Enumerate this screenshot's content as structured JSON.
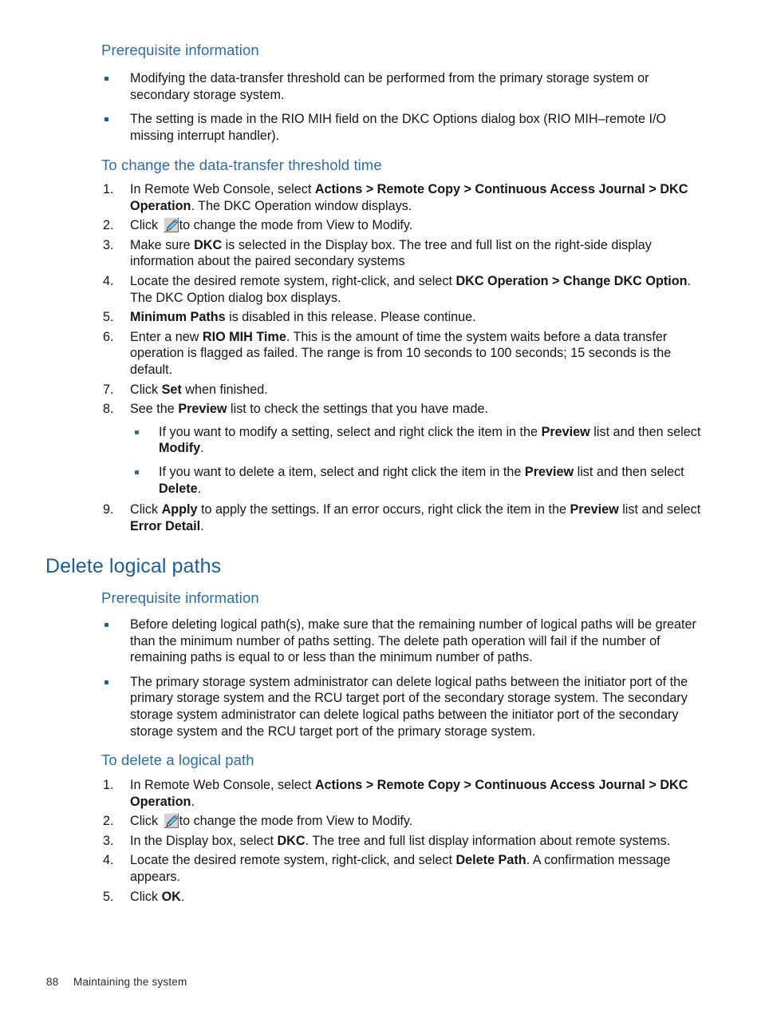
{
  "document": {
    "footer": {
      "page_number": "88",
      "chapter": "Maintaining the system"
    },
    "colors": {
      "heading_primary": "#1b5e9e",
      "heading_secondary": "#2d6ca8",
      "body": "#161616",
      "bullet": "#1b5e9e"
    }
  },
  "section_a": {
    "prereq_heading": "Prerequisite information",
    "prereq_bullets": [
      {
        "parts": [
          {
            "t": "Modifying the data-transfer threshold can be performed from the primary storage system or secondary storage system.",
            "b": false
          }
        ]
      },
      {
        "parts": [
          {
            "t": "The setting is made in the RIO MIH field on the DKC Options dialog box (RIO MIH–remote I/O missing interrupt handler).",
            "b": false
          }
        ]
      }
    ],
    "procedure_heading": "To change the data-transfer threshold time",
    "steps": [
      {
        "num": "1.",
        "parts": [
          {
            "t": "In Remote Web Console, select ",
            "b": false
          },
          {
            "t": "Actions > Remote Copy > Continuous Access Journal > DKC Operation",
            "b": true
          },
          {
            "t": ". The DKC Operation window displays.",
            "b": false
          }
        ]
      },
      {
        "num": "2.",
        "icon": "pencil-icon",
        "parts": [
          {
            "t": "Click ",
            "b": false
          },
          {
            "t": "__ICON__",
            "b": false
          },
          {
            "t": "to change the mode from View to Modify.",
            "b": false
          }
        ]
      },
      {
        "num": "3.",
        "parts": [
          {
            "t": "Make sure ",
            "b": false
          },
          {
            "t": "DKC",
            "b": true
          },
          {
            "t": " is selected in the Display box. The tree and full list on the right-side display information about the paired secondary systems",
            "b": false
          }
        ]
      },
      {
        "num": "4.",
        "parts": [
          {
            "t": "Locate the desired remote system, right-click, and select ",
            "b": false
          },
          {
            "t": "DKC Operation > Change DKC Option",
            "b": true
          },
          {
            "t": ". The DKC Option dialog box displays.",
            "b": false
          }
        ]
      },
      {
        "num": "5.",
        "parts": [
          {
            "t": "Minimum Paths",
            "b": true
          },
          {
            "t": " is disabled in this release. Please continue.",
            "b": false
          }
        ]
      },
      {
        "num": "6.",
        "parts": [
          {
            "t": "Enter a new ",
            "b": false
          },
          {
            "t": "RIO MIH Time",
            "b": true
          },
          {
            "t": ". This is the amount of time the system waits before a data transfer operation is flagged as failed. The range is from 10 seconds to 100 seconds; 15 seconds is the default.",
            "b": false
          }
        ]
      },
      {
        "num": "7.",
        "parts": [
          {
            "t": "Click ",
            "b": false
          },
          {
            "t": "Set",
            "b": true
          },
          {
            "t": " when finished.",
            "b": false
          }
        ]
      },
      {
        "num": "8.",
        "parts": [
          {
            "t": "See the ",
            "b": false
          },
          {
            "t": "Preview",
            "b": true
          },
          {
            "t": " list to check the settings that you have made.",
            "b": false
          }
        ],
        "subbullets": [
          {
            "parts": [
              {
                "t": "If you want to modify a setting, select and right click the item in the ",
                "b": false
              },
              {
                "t": "Preview",
                "b": true
              },
              {
                "t": " list and then select ",
                "b": false
              },
              {
                "t": "Modify",
                "b": true
              },
              {
                "t": ".",
                "b": false
              }
            ]
          },
          {
            "parts": [
              {
                "t": "If you want to delete a item, select and right click the item in the ",
                "b": false
              },
              {
                "t": "Preview",
                "b": true
              },
              {
                "t": " list and then select ",
                "b": false
              },
              {
                "t": "Delete",
                "b": true
              },
              {
                "t": ".",
                "b": false
              }
            ]
          }
        ]
      },
      {
        "num": "9.",
        "parts": [
          {
            "t": "Click ",
            "b": false
          },
          {
            "t": "Apply",
            "b": true
          },
          {
            "t": " to apply the settings. If an error occurs, right click the item in the ",
            "b": false
          },
          {
            "t": "Preview",
            "b": true
          },
          {
            "t": " list and select ",
            "b": false
          },
          {
            "t": "Error Detail",
            "b": true
          },
          {
            "t": ".",
            "b": false
          }
        ]
      }
    ]
  },
  "section_b": {
    "title": "Delete logical paths",
    "prereq_heading": "Prerequisite information",
    "prereq_bullets": [
      {
        "parts": [
          {
            "t": "Before deleting logical path(s), make sure that the remaining number of logical paths will be greater than the minimum number of paths setting. The delete path operation will fail if the number of remaining paths is equal to or less than the minimum number of paths.",
            "b": false
          }
        ]
      },
      {
        "parts": [
          {
            "t": "The primary storage system administrator can delete logical paths between the initiator port of the primary storage system and the RCU target port of the secondary storage system. The secondary storage system administrator can delete logical paths between the initiator port of the secondary storage system and the RCU target port of the primary storage system.",
            "b": false
          }
        ]
      }
    ],
    "procedure_heading": "To delete a logical path",
    "steps": [
      {
        "num": "1.",
        "parts": [
          {
            "t": "In Remote Web Console, select ",
            "b": false
          },
          {
            "t": "Actions > Remote Copy > Continuous Access Journal > DKC Operation",
            "b": true
          },
          {
            "t": ".",
            "b": false
          }
        ]
      },
      {
        "num": "2.",
        "icon": "pencil-icon",
        "parts": [
          {
            "t": "Click ",
            "b": false
          },
          {
            "t": "__ICON__",
            "b": false
          },
          {
            "t": "to change the mode from View to Modify.",
            "b": false
          }
        ]
      },
      {
        "num": "3.",
        "parts": [
          {
            "t": "In the Display box, select ",
            "b": false
          },
          {
            "t": "DKC",
            "b": true
          },
          {
            "t": ". The tree and full list display information about remote systems.",
            "b": false
          }
        ]
      },
      {
        "num": "4.",
        "parts": [
          {
            "t": "Locate the desired remote system, right-click, and select ",
            "b": false
          },
          {
            "t": "Delete Path",
            "b": true
          },
          {
            "t": ". A confirmation message appears.",
            "b": false
          }
        ]
      },
      {
        "num": "5.",
        "parts": [
          {
            "t": "Click ",
            "b": false
          },
          {
            "t": "OK",
            "b": true
          },
          {
            "t": ".",
            "b": false
          }
        ]
      }
    ]
  }
}
